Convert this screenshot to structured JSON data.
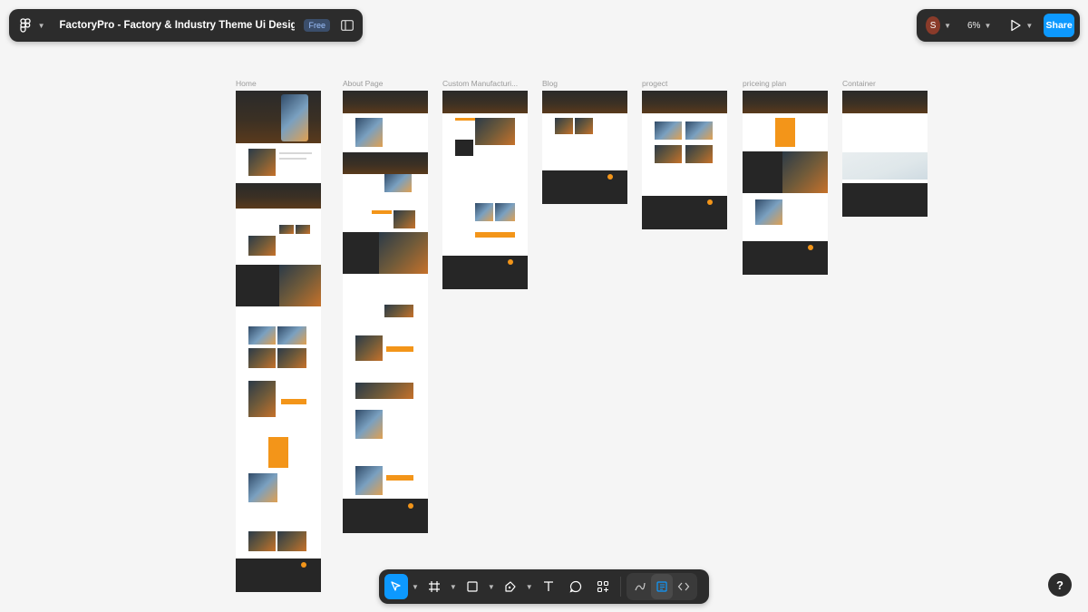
{
  "header": {
    "file_title": "FactoryPro - Factory & Industry Theme Ui Design (fig...",
    "plan_badge": "Free",
    "avatar_initial": "S",
    "zoom": "6%",
    "share_label": "Share"
  },
  "canvas": {
    "frames": [
      {
        "label": "Home"
      },
      {
        "label": "About Page"
      },
      {
        "label": "Custom Manufacturi..."
      },
      {
        "label": "Blog"
      },
      {
        "label": "progect"
      },
      {
        "label": "priceing plan"
      },
      {
        "label": "Container"
      }
    ]
  },
  "bottom_toolbar": {
    "tools": [
      "move-tool",
      "frame-tool",
      "shape-tool",
      "pen-tool",
      "text-tool",
      "comment-tool",
      "actions-tool"
    ],
    "dev_tools": [
      "draw-mode",
      "design-mode",
      "dev-mode"
    ]
  },
  "help_label": "?",
  "colors": {
    "accent": "#0d99ff",
    "toolbar": "#2c2c2c",
    "canvas": "#f5f5f5",
    "brand_orange": "#f39519"
  }
}
